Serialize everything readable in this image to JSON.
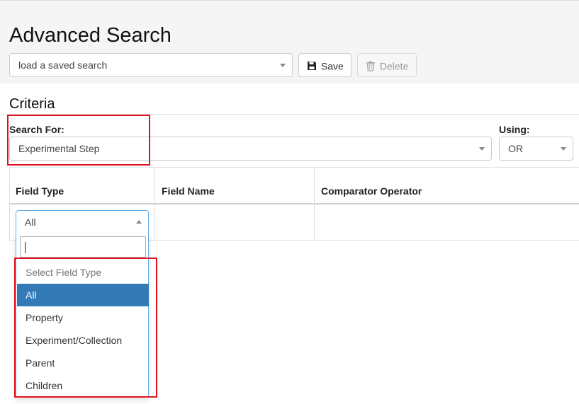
{
  "page": {
    "title": "Advanced Search"
  },
  "saved_search": {
    "selected": "load a saved search"
  },
  "toolbar": {
    "save_label": "Save",
    "delete_label": "Delete"
  },
  "criteria": {
    "heading": "Criteria",
    "search_for_label": "Search For:",
    "search_for_value": "Experimental Step",
    "using_label": "Using:",
    "using_value": "OR"
  },
  "table": {
    "columns": [
      "Field Type",
      "Field Name",
      "Comparator Operator"
    ],
    "field_type_value": "All"
  },
  "field_type_dropdown": {
    "search_value": "",
    "options": [
      "Select Field Type",
      "All",
      "Property",
      "Experiment/Collection",
      "Parent",
      "Children"
    ],
    "selected": "All"
  },
  "colors": {
    "highlight": "#e0141e",
    "selected_option": "#337ab7",
    "focus_border": "#66afe9"
  },
  "icons": {
    "save": "floppy-disk-icon",
    "delete": "trash-icon"
  }
}
